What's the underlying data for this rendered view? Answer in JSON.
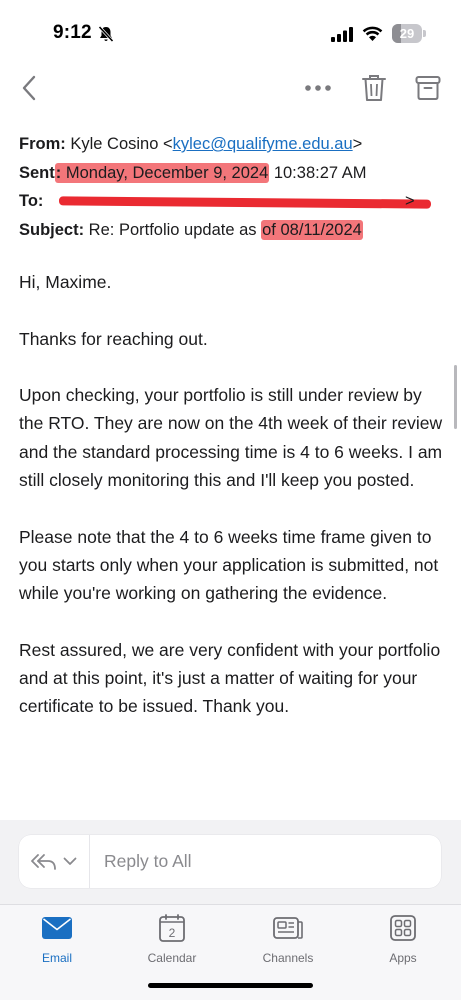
{
  "status_bar": {
    "time": "9:12",
    "battery_level": "29",
    "battery_fraction": 0.29,
    "icons": [
      "bell-slash-icon",
      "signal-icon",
      "wifi-icon",
      "battery-icon"
    ]
  },
  "toolbar": {
    "icons": [
      "chevron-left-icon",
      "ellipsis-icon",
      "trash-icon",
      "archive-icon"
    ]
  },
  "email": {
    "from_label": "From:",
    "from_name": "Kyle Cosino",
    "from_open": "<",
    "from_email": "kylec@qualifyme.edu.au",
    "from_close": ">",
    "sent_label_a": "Sent",
    "sent_label_b": ":",
    "sent_highlighted": " Monday, December 9, 2024",
    "sent_time": " 10:38:27 AM",
    "to_label": "To:",
    "to_tail": ">",
    "subject_label": "Subject:",
    "subject_text": " Re: Portfolio update as ",
    "subject_highlighted": "of 08/11/2024",
    "highlight_color": "#f3767a",
    "redaction_color": "#ea2a31"
  },
  "body": {
    "greeting": "Hi, Maxime.",
    "p1": "Thanks for reaching out.",
    "p2": "Upon checking, your portfolio is still under review by the RTO. They are now on the 4th week of their review and the standard processing time is 4 to 6 weeks. I am still closely monitoring this and I'll keep you posted.",
    "p3": "Please note that the 4 to 6 weeks time frame given to you starts only when your application is submitted, not while you're working on gathering the evidence.",
    "p4": "Rest assured, we are very confident with your portfolio and at this point, it's just a matter of waiting for your certificate to be issued. Thank you."
  },
  "reply": {
    "placeholder": "Reply to All"
  },
  "tabs": [
    {
      "label": "Email",
      "icon": "envelope-icon",
      "active": true
    },
    {
      "label": "Calendar",
      "icon": "calendar-icon",
      "badge": "2"
    },
    {
      "label": "Channels",
      "icon": "channels-icon"
    },
    {
      "label": "Apps",
      "icon": "apps-grid-icon"
    }
  ],
  "colors": {
    "accent": "#1a6fc2",
    "text": "#1c1c1e",
    "secondary": "#6d6d72"
  }
}
